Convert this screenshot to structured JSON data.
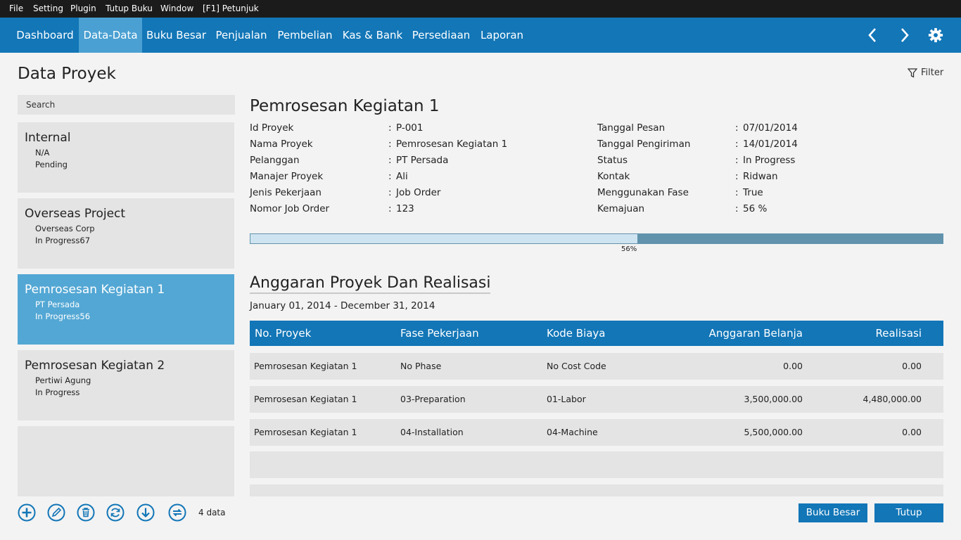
{
  "menu": [
    "File",
    "Setting",
    "Plugin",
    "Tutup Buku",
    "Window",
    "[F1] Petunjuk"
  ],
  "nav": {
    "tabs": [
      "Dashboard",
      "Data-Data",
      "Buku Besar",
      "Penjualan",
      "Pembelian",
      "Kas & Bank",
      "Persediaan",
      "Laporan"
    ],
    "active": "Data-Data",
    "icons": [
      "chevron-left-icon",
      "chevron-right-icon",
      "gear-icon"
    ]
  },
  "page": {
    "title": "Data Proyek",
    "filter_label": "Filter"
  },
  "search": {
    "placeholder": "Search"
  },
  "projects": [
    {
      "name": "Internal",
      "customer": "N/A",
      "status": "Pending"
    },
    {
      "name": "Overseas Project",
      "customer": "Overseas Corp",
      "status": "In Progress67"
    },
    {
      "name": "Pemrosesan Kegiatan 1",
      "customer": "PT Persada",
      "status": "In Progress56"
    },
    {
      "name": "Pemrosesan Kegiatan 2",
      "customer": "Pertiwi Agung",
      "status": "In Progress"
    }
  ],
  "selected_project_index": 2,
  "toolbar": {
    "icons": [
      "add-icon",
      "edit-icon",
      "delete-icon",
      "refresh-icon",
      "download-icon",
      "sync-icon"
    ],
    "count": "4 data"
  },
  "detail": {
    "title": "Pemrosesan Kegiatan 1",
    "left_fields": [
      {
        "label": "Id Proyek",
        "value": "P-001"
      },
      {
        "label": "Nama Proyek",
        "value": "Pemrosesan Kegiatan 1"
      },
      {
        "label": "Pelanggan",
        "value": "PT Persada"
      },
      {
        "label": "Manajer Proyek",
        "value": "Ali"
      },
      {
        "label": "Jenis Pekerjaan",
        "value": "Job Order"
      },
      {
        "label": "Nomor Job Order",
        "value": "123"
      }
    ],
    "right_fields": [
      {
        "label": "Tanggal Pesan",
        "value": "07/01/2014"
      },
      {
        "label": "Tanggal Pengiriman",
        "value": "14/01/2014"
      },
      {
        "label": "Status",
        "value": "In Progress"
      },
      {
        "label": "Kontak",
        "value": "Ridwan"
      },
      {
        "label": "Menggunakan Fase",
        "value": "True"
      },
      {
        "label": "Kemajuan",
        "value": "56 %"
      }
    ],
    "progress": {
      "value": 0.56,
      "label": "56%"
    }
  },
  "budget": {
    "title": "Anggaran Proyek Dan Realisasi",
    "date_range": "January 01, 2014 - December 31, 2014",
    "columns": [
      "No. Proyek",
      "Fase Pekerjaan",
      "Kode Biaya",
      "Anggaran Belanja",
      "Realisasi"
    ],
    "rows": [
      [
        "Pemrosesan Kegiatan 1",
        "No Phase",
        "No Cost Code",
        "0.00",
        "0.00"
      ],
      [
        "Pemrosesan Kegiatan 1",
        "03-Preparation",
        "01-Labor",
        "3,500,000.00",
        "4,480,000.00"
      ],
      [
        "Pemrosesan Kegiatan 1",
        "04-Installation",
        "04-Machine",
        "5,500,000.00",
        "0.00"
      ]
    ]
  },
  "buttons": {
    "ledger": "Buku Besar",
    "close": "Tutup"
  },
  "colors": {
    "accent": "#1276b7",
    "selected": "#53a7d4",
    "menubar": "#1b1b1b",
    "progress_track": "#6193ad",
    "progress_fill": "#cfe4f1"
  }
}
